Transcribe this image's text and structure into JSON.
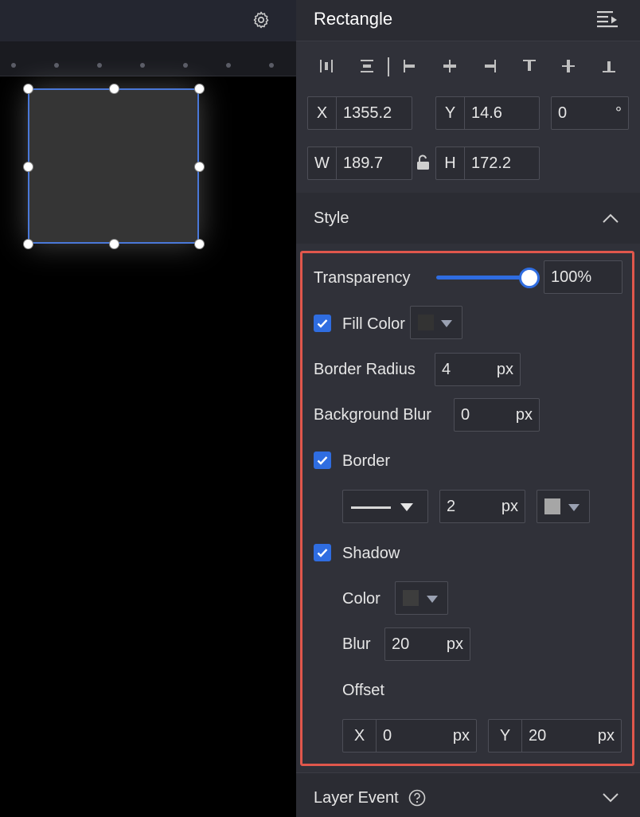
{
  "panel": {
    "title": "Rectangle"
  },
  "geometry": {
    "x_label": "X",
    "x_value": "1355.2",
    "y_label": "Y",
    "y_value": "14.6",
    "rotation_value": "0",
    "rotation_unit": "°",
    "w_label": "W",
    "w_value": "189.7",
    "h_label": "H",
    "h_value": "172.2"
  },
  "style": {
    "section_title": "Style",
    "transparency_label": "Transparency",
    "transparency_value": "100%",
    "transparency_level": 1.0,
    "fill_color_label": "Fill Color",
    "fill_color": "#333333",
    "border_radius_label": "Border Radius",
    "border_radius_value": "4",
    "background_blur_label": "Background Blur",
    "background_blur_value": "0",
    "unit_px": "px",
    "border_label": "Border",
    "border_width_value": "2",
    "border_color": "#a6a6a6",
    "shadow_label": "Shadow",
    "shadow_color_label": "Color",
    "shadow_color": "#3d3d3d",
    "shadow_blur_label": "Blur",
    "shadow_blur_value": "20",
    "offset_label": "Offset",
    "offset_x_label": "X",
    "offset_x_value": "0",
    "offset_y_label": "Y",
    "offset_y_value": "20"
  },
  "layer_event": {
    "title": "Layer Event"
  },
  "colors": {
    "accent": "#2f6de1",
    "highlight": "#e0574c",
    "selection": "#4a78d8"
  }
}
